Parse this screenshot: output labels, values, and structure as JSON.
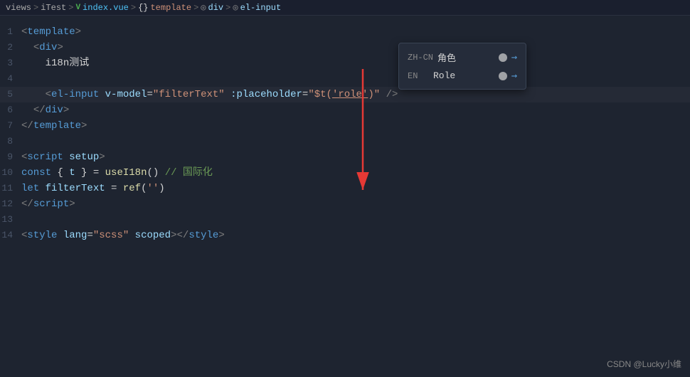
{
  "breadcrumb": {
    "views": "views",
    "sep1": ">",
    "itest": "iTest",
    "sep2": ">",
    "v_icon": "V",
    "indexvue": "index.vue",
    "sep3": ">",
    "curly": "{}",
    "template": "template",
    "sep4": ">",
    "div_icon": "◎",
    "div": "div",
    "sep5": ">",
    "input_icon": "◎",
    "el_input": "el-input"
  },
  "tooltip": {
    "row1_lang": "ZH-CN",
    "row1_text": "角色",
    "row2_lang": "EN",
    "row2_text": "Role"
  },
  "lines": [
    {
      "num": "",
      "indent": "",
      "content_raw": "template"
    },
    {
      "num": "1",
      "indent": "",
      "parts": "template_open"
    },
    {
      "num": "2",
      "indent": "  ",
      "parts": "div_open"
    },
    {
      "num": "3",
      "indent": "    ",
      "parts": "i18n_text"
    },
    {
      "num": "4",
      "indent": "",
      "parts": "empty"
    },
    {
      "num": "5",
      "indent": "    ",
      "parts": "el_input_line"
    },
    {
      "num": "6",
      "indent": "  ",
      "parts": "div_close"
    },
    {
      "num": "7",
      "indent": "",
      "parts": "template_close"
    },
    {
      "num": "8",
      "indent": "",
      "parts": "empty"
    },
    {
      "num": "9",
      "indent": "",
      "parts": "script_open"
    },
    {
      "num": "10",
      "indent": "",
      "parts": "const_line"
    },
    {
      "num": "11",
      "indent": "",
      "parts": "let_line"
    },
    {
      "num": "12",
      "indent": "",
      "parts": "script_close"
    },
    {
      "num": "13",
      "indent": "",
      "parts": "empty"
    },
    {
      "num": "14",
      "indent": "",
      "parts": "style_line"
    }
  ],
  "watermark": {
    "text": "CSDN @Lucky小维"
  }
}
